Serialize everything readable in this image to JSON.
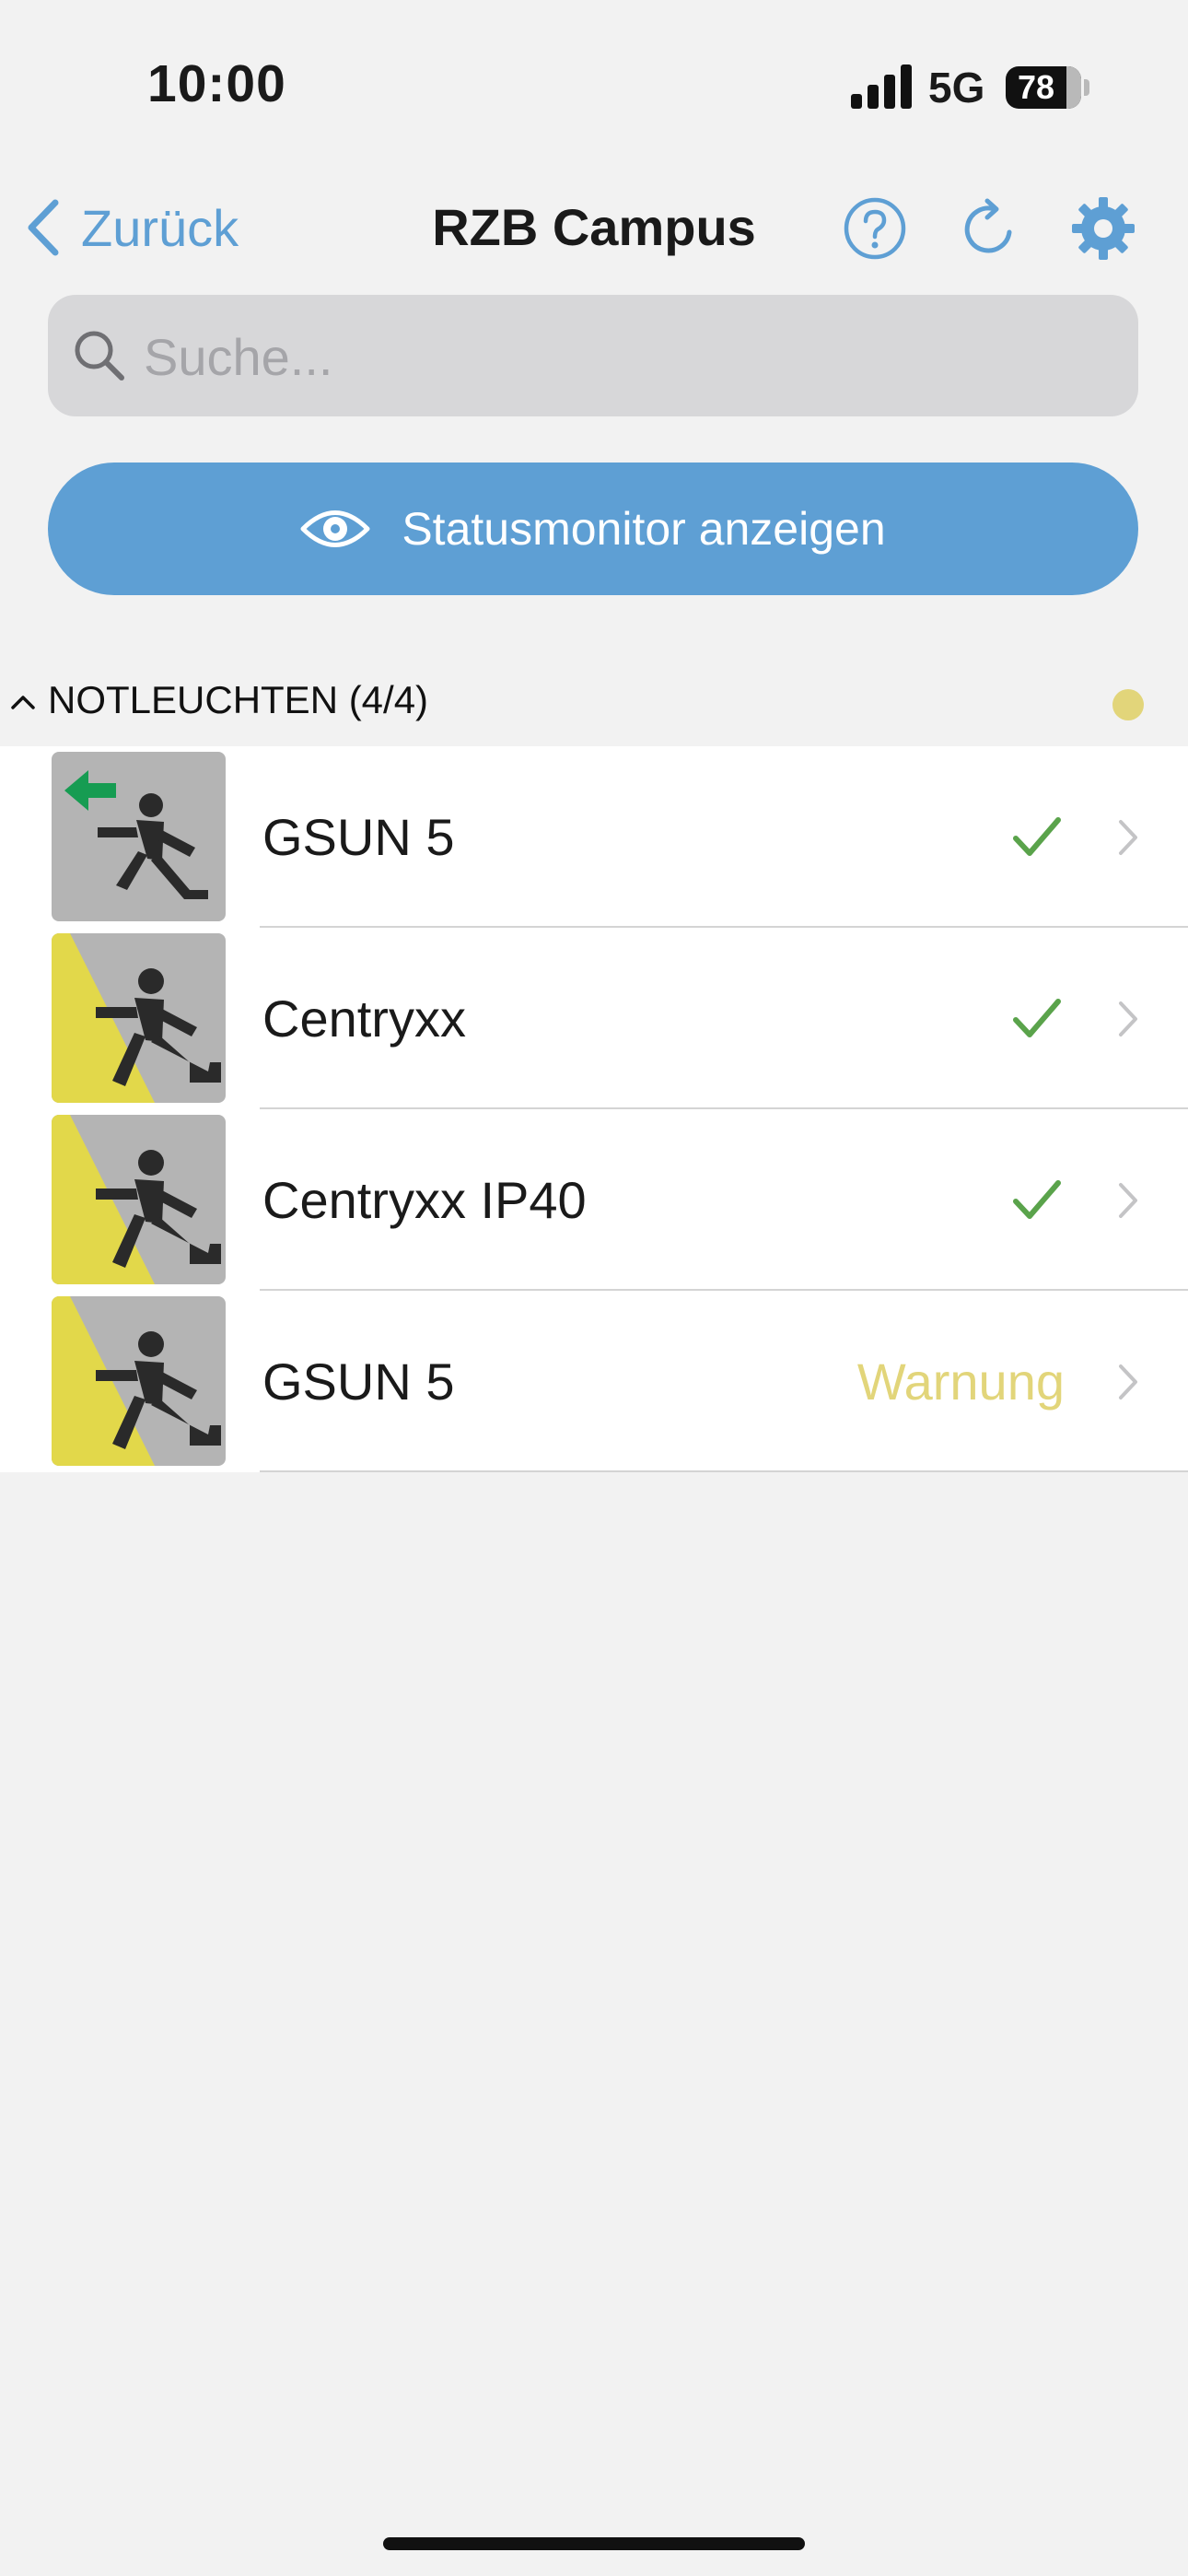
{
  "status_bar": {
    "time": "10:00",
    "network": "5G",
    "battery": "78",
    "icons": [
      "signal-icon",
      "battery-icon"
    ]
  },
  "nav": {
    "back_label": "Zurück",
    "title": "RZB Campus",
    "icons": [
      "help-icon",
      "refresh-icon",
      "gear-icon"
    ]
  },
  "search": {
    "placeholder": "Suche...",
    "value": ""
  },
  "monitor_button": {
    "label": "Statusmonitor anzeigen",
    "icon": "eye-icon"
  },
  "section": {
    "title": "NOTLEUCHTEN (4/4)",
    "status_color": "#e2d57a"
  },
  "items": [
    {
      "name": "GSUN 5",
      "status": "ok",
      "thumbnail": "exit-sign-arrow-left"
    },
    {
      "name": "Centryxx",
      "status": "ok",
      "thumbnail": "exit-sign-yellow"
    },
    {
      "name": "Centryxx IP40",
      "status": "ok",
      "thumbnail": "exit-sign-yellow"
    },
    {
      "name": "GSUN 5",
      "status": "warning",
      "status_label": "Warnung",
      "thumbnail": "exit-sign-yellow"
    }
  ],
  "colors": {
    "accent": "#5e9fd4",
    "ok": "#5aa34b",
    "warning": "#e2d57a",
    "exit_green": "#169c52",
    "thumb_yellow": "#e2d84a",
    "thumb_gray": "#b4b4b4"
  }
}
